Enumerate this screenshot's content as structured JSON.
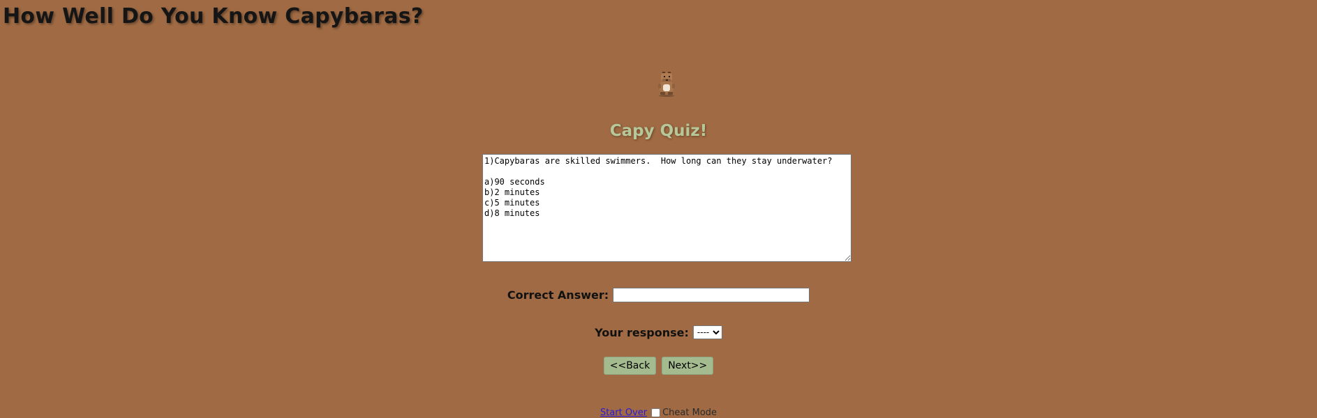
{
  "page": {
    "heading": "How Well Do You Know Capybaras?"
  },
  "mascot": {
    "icon": "capybara-icon"
  },
  "quiz": {
    "title": "Capy Quiz!",
    "question_text": "1)Capybaras are skilled swimmers.  How long can they stay underwater?\n\na)90 seconds\nb)2 minutes\nc)5 minutes\nd)8 minutes"
  },
  "answer": {
    "label": "Correct Answer:",
    "value": ""
  },
  "response": {
    "label": "Your response:",
    "selected": "----"
  },
  "buttons": {
    "back": "<<Back",
    "next": "Next>>"
  },
  "footer": {
    "start_over": "Start Over",
    "cheat_mode": "Cheat Mode"
  },
  "colors": {
    "background": "#a06b44",
    "title": "#b6c79a",
    "button": "#a3bb8e",
    "link": "#2a1ad6"
  }
}
